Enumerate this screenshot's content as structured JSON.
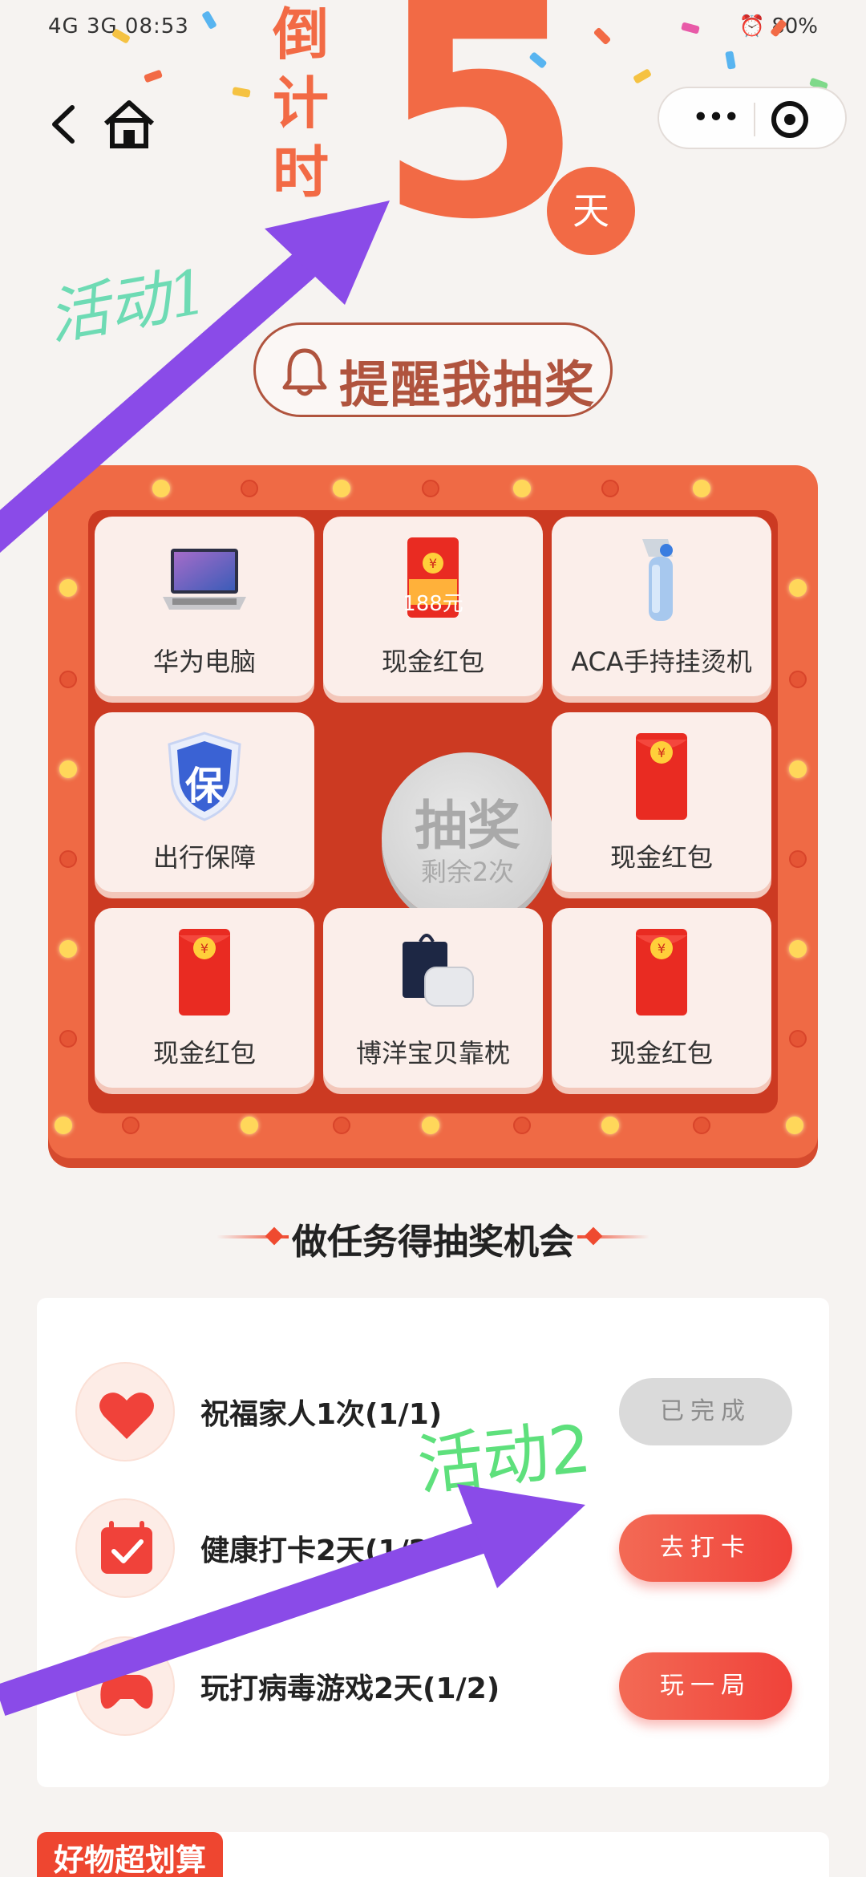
{
  "status_bar": {
    "left": "4G 3G 08:53",
    "right": "⏰ 80%"
  },
  "nav": {
    "back": "‹",
    "home": "home",
    "more": "•••"
  },
  "countdown": {
    "label_lines": [
      "倒",
      "计",
      "时"
    ],
    "number": "5",
    "unit": "天"
  },
  "annotations": {
    "first": "活动1",
    "second": "活动2"
  },
  "remind": {
    "label": "提醒我抽奖"
  },
  "lottery": {
    "prizes": [
      {
        "name": "华为电脑",
        "icon": "laptop-icon"
      },
      {
        "name": "现金红包",
        "icon": "red-envelope-188-icon",
        "amount": "188元"
      },
      {
        "name": "ACA手持挂烫机",
        "icon": "steamer-icon"
      },
      {
        "name": "出行保障",
        "icon": "shield-icon",
        "badge": "保"
      },
      {
        "name": "现金红包",
        "icon": "red-envelope-icon"
      },
      {
        "name": "现金红包",
        "icon": "red-envelope-icon"
      },
      {
        "name": "博洋宝贝靠枕",
        "icon": "pillow-icon"
      },
      {
        "name": "现金红包",
        "icon": "red-envelope-icon"
      }
    ],
    "draw": {
      "title": "抽奖",
      "remaining": "剩余2次"
    },
    "colors": {
      "frame": "#ef6a45",
      "inner": "#cc3a22",
      "bulb": "#ffd75a"
    }
  },
  "tasks": {
    "title": "做任务得抽奖机会",
    "items": [
      {
        "label": "祝福家人1次(1/1)",
        "button": "已完成",
        "icon": "heart-icon"
      },
      {
        "label": "健康打卡2天(1/2)",
        "button": "去打卡",
        "icon": "calendar-check-icon"
      },
      {
        "label": "玩打病毒游戏2天(1/2)",
        "button": "玩一局",
        "icon": "gamepad-icon"
      }
    ]
  },
  "banner": {
    "tag": "好物超划算"
  }
}
